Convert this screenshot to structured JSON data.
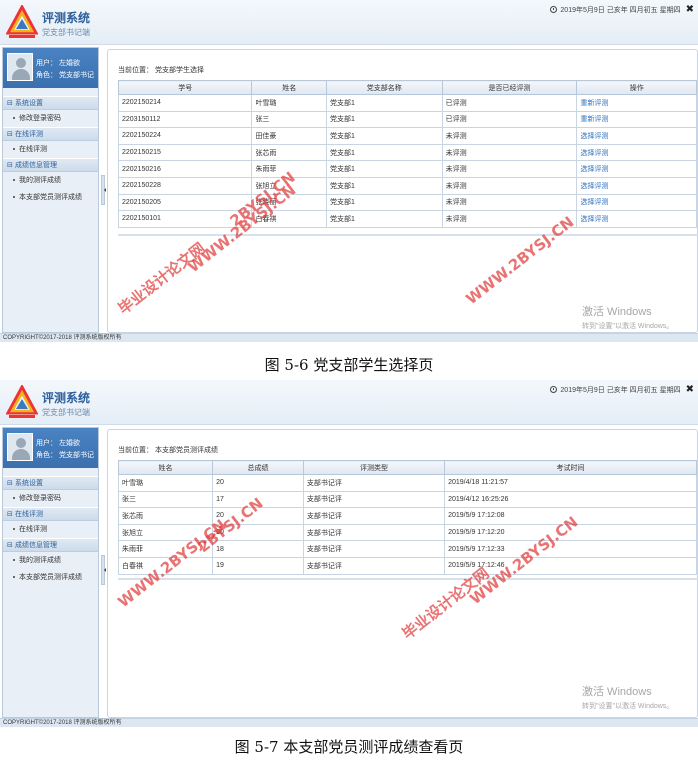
{
  "header": {
    "app_title": "评测系统",
    "app_subtitle": "党支部书记端",
    "date_text": "2019年5月9日 己亥年 四月初五 星期四",
    "close_glyph": "✖",
    "icons": [
      "logo-icon",
      "clock-icon",
      "close-icon"
    ]
  },
  "sidebar": {
    "user_line": "用户：  左婚欲",
    "role_line": "角色：  党支部书记",
    "groups": [
      {
        "label": "系统设置",
        "toggle": "⊟",
        "items": [
          "修改登录密码"
        ]
      },
      {
        "label": "在线评测",
        "toggle": "⊟",
        "items": [
          "在线评测"
        ]
      },
      {
        "label": "成绩信息管理",
        "toggle": "⊟",
        "items": [
          "我的测评成绩",
          "本支部党员测评成绩"
        ]
      }
    ]
  },
  "page1": {
    "breadcrumb": "当前位置：  党支部学生选择",
    "columns": [
      "学号",
      "姓名",
      "党支部名称",
      "是否已经评测",
      "操作"
    ],
    "rows": [
      [
        "2202150214",
        "叶雪璐",
        "党支部1",
        "已评测",
        "重新评测"
      ],
      [
        "2203150112",
        "张三",
        "党支部1",
        "已评测",
        "重新评测"
      ],
      [
        "2202150224",
        "田佳豪",
        "党支部1",
        "未评测",
        "选择评测"
      ],
      [
        "2202150215",
        "张芯雨",
        "党支部1",
        "未评测",
        "选择评测"
      ],
      [
        "2202150216",
        "朱雨菲",
        "党支部1",
        "未评测",
        "选择评测"
      ],
      [
        "2202150228",
        "张旭立",
        "党支部1",
        "未评测",
        "选择评测"
      ],
      [
        "2202150205",
        "张晓丽",
        "党支部1",
        "未评测",
        "选择评测"
      ],
      [
        "2202150101",
        "白春祺",
        "党支部1",
        "未评测",
        "选择评测"
      ]
    ],
    "caption": "图 5-6 党支部学生选择页"
  },
  "page2": {
    "breadcrumb": "当前位置：  本支部党员测评成绩",
    "columns": [
      "姓名",
      "总成绩",
      "评测类型",
      "考试时间"
    ],
    "rows": [
      [
        "叶雪璐",
        "20",
        "支部书记评",
        "2019/4/18 11:21:57"
      ],
      [
        "张三",
        "17",
        "支部书记评",
        "2019/4/12 16:25:26"
      ],
      [
        "张芯雨",
        "20",
        "支部书记评",
        "2019/5/9 17:12:08"
      ],
      [
        "张旭立",
        "20",
        "支部书记评",
        "2019/5/9 17:12:20"
      ],
      [
        "朱雨菲",
        "18",
        "支部书记评",
        "2019/5/9 17:12:33"
      ],
      [
        "白春祺",
        "19",
        "支部书记评",
        "2019/5/9 17:12:46"
      ]
    ],
    "caption": "图 5-7 本支部党员测评成绩查看页"
  },
  "watermarks": {
    "site": "WWW.2BYSJ.CN",
    "site_short": "2BYSJ.CN",
    "brand": "毕业设计论文网"
  },
  "activate": {
    "title": "激活 Windows",
    "sub": "转到\"设置\"以激活 Windows。"
  },
  "footer": "COPYRIGHT©2017-2018 评测系统版权所有"
}
